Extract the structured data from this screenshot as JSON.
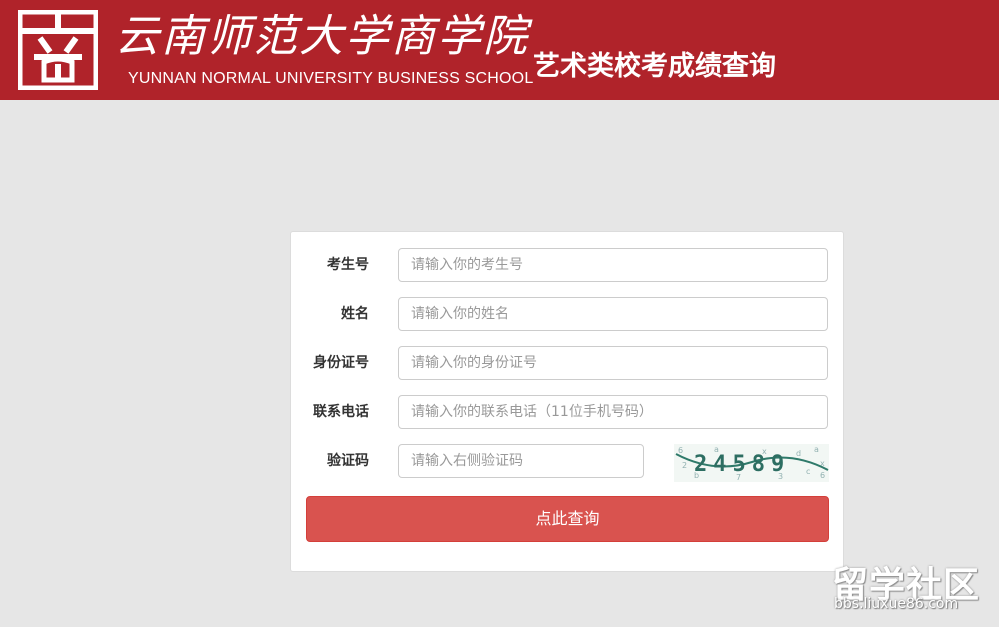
{
  "header": {
    "logo_mark": "商",
    "school_name_cn": "云南师范大学商学院",
    "school_name_en": "YUNNAN NORMAL UNIVERSITY BUSINESS SCHOOL",
    "title": "艺术类校考成绩查询",
    "brand_color": "#b0232a"
  },
  "form": {
    "fields": [
      {
        "label": "考生号",
        "placeholder": "请输入你的考生号",
        "value": ""
      },
      {
        "label": "姓名",
        "placeholder": "请输入你的姓名",
        "value": ""
      },
      {
        "label": "身份证号",
        "placeholder": "请输入你的身份证号",
        "value": ""
      },
      {
        "label": "联系电话",
        "placeholder": "请输入你的联系电话（11位手机号码）",
        "value": ""
      },
      {
        "label": "验证码",
        "placeholder": "请输入右侧验证码",
        "value": ""
      }
    ],
    "captcha_text": "24589",
    "submit_label": "点此查询",
    "submit_color": "#d9534f"
  },
  "watermark": {
    "text_cn": "留学社区",
    "url": "bbs.liuxue86.com"
  }
}
